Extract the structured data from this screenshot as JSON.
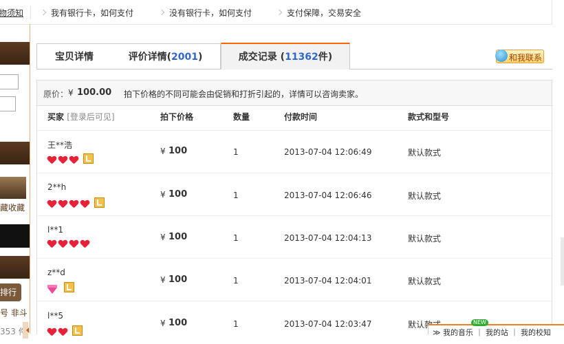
{
  "topbar": {
    "items": [
      "购物须知",
      "我有银行卡，如何支付",
      "没有银行卡，如何支付",
      "支付保障，交易安全"
    ]
  },
  "sidebar": {
    "collect_text": "藏收藏",
    "rank_text": "排行",
    "frag1": "号 非斗",
    "frag2": "353 件"
  },
  "tabs": [
    {
      "label": "宝贝详情",
      "count": "",
      "suffix": ""
    },
    {
      "label": "评价详情(",
      "count": "2001",
      "suffix": ")"
    },
    {
      "label": "成交记录 (",
      "count": "11362",
      "suffix": "件)"
    }
  ],
  "contact": {
    "label": "和我联系",
    "icon": "smiley-icon"
  },
  "pricebar": {
    "label": "原价：",
    "currency": "¥",
    "price": "100.00",
    "note": "拍下价格的不同可能会由促销和打折引起的，详情可以咨询卖家。"
  },
  "table": {
    "headers": {
      "buyer": "买家",
      "buyer_note": "[登录后可见]",
      "price": "拍下价格",
      "qty": "数量",
      "time": "付款时间",
      "style": "款式和型号"
    },
    "rows": [
      {
        "buyer": "王**浩",
        "currency": "¥",
        "price": "100",
        "qty": "1",
        "time": "2013-07-04 12:06:49",
        "style": "默认款式"
      },
      {
        "buyer": "2**h",
        "currency": "¥",
        "price": "100",
        "qty": "1",
        "time": "2013-07-04 12:06:46",
        "style": "默认款式"
      },
      {
        "buyer": "l**1",
        "currency": "¥",
        "price": "100",
        "qty": "1",
        "time": "2013-07-04 12:04:13",
        "style": "默认款式"
      },
      {
        "buyer": "z**d",
        "currency": "¥",
        "price": "100",
        "qty": "1",
        "time": "2013-07-04 12:04:01",
        "style": "默认款式"
      },
      {
        "buyer": "l**5",
        "currency": "¥",
        "price": "100",
        "qty": "1",
        "time": "2013-07-04 12:03:47",
        "style": "默认款式"
      }
    ]
  },
  "music_bar": {
    "new_badge": "NEW",
    "text": "≫ 我的音乐 ｜ 我的站 ｜ 我的校知"
  },
  "colors": {
    "accent": "#ff6600",
    "link": "#3366cc",
    "heart": "#e6223a"
  }
}
